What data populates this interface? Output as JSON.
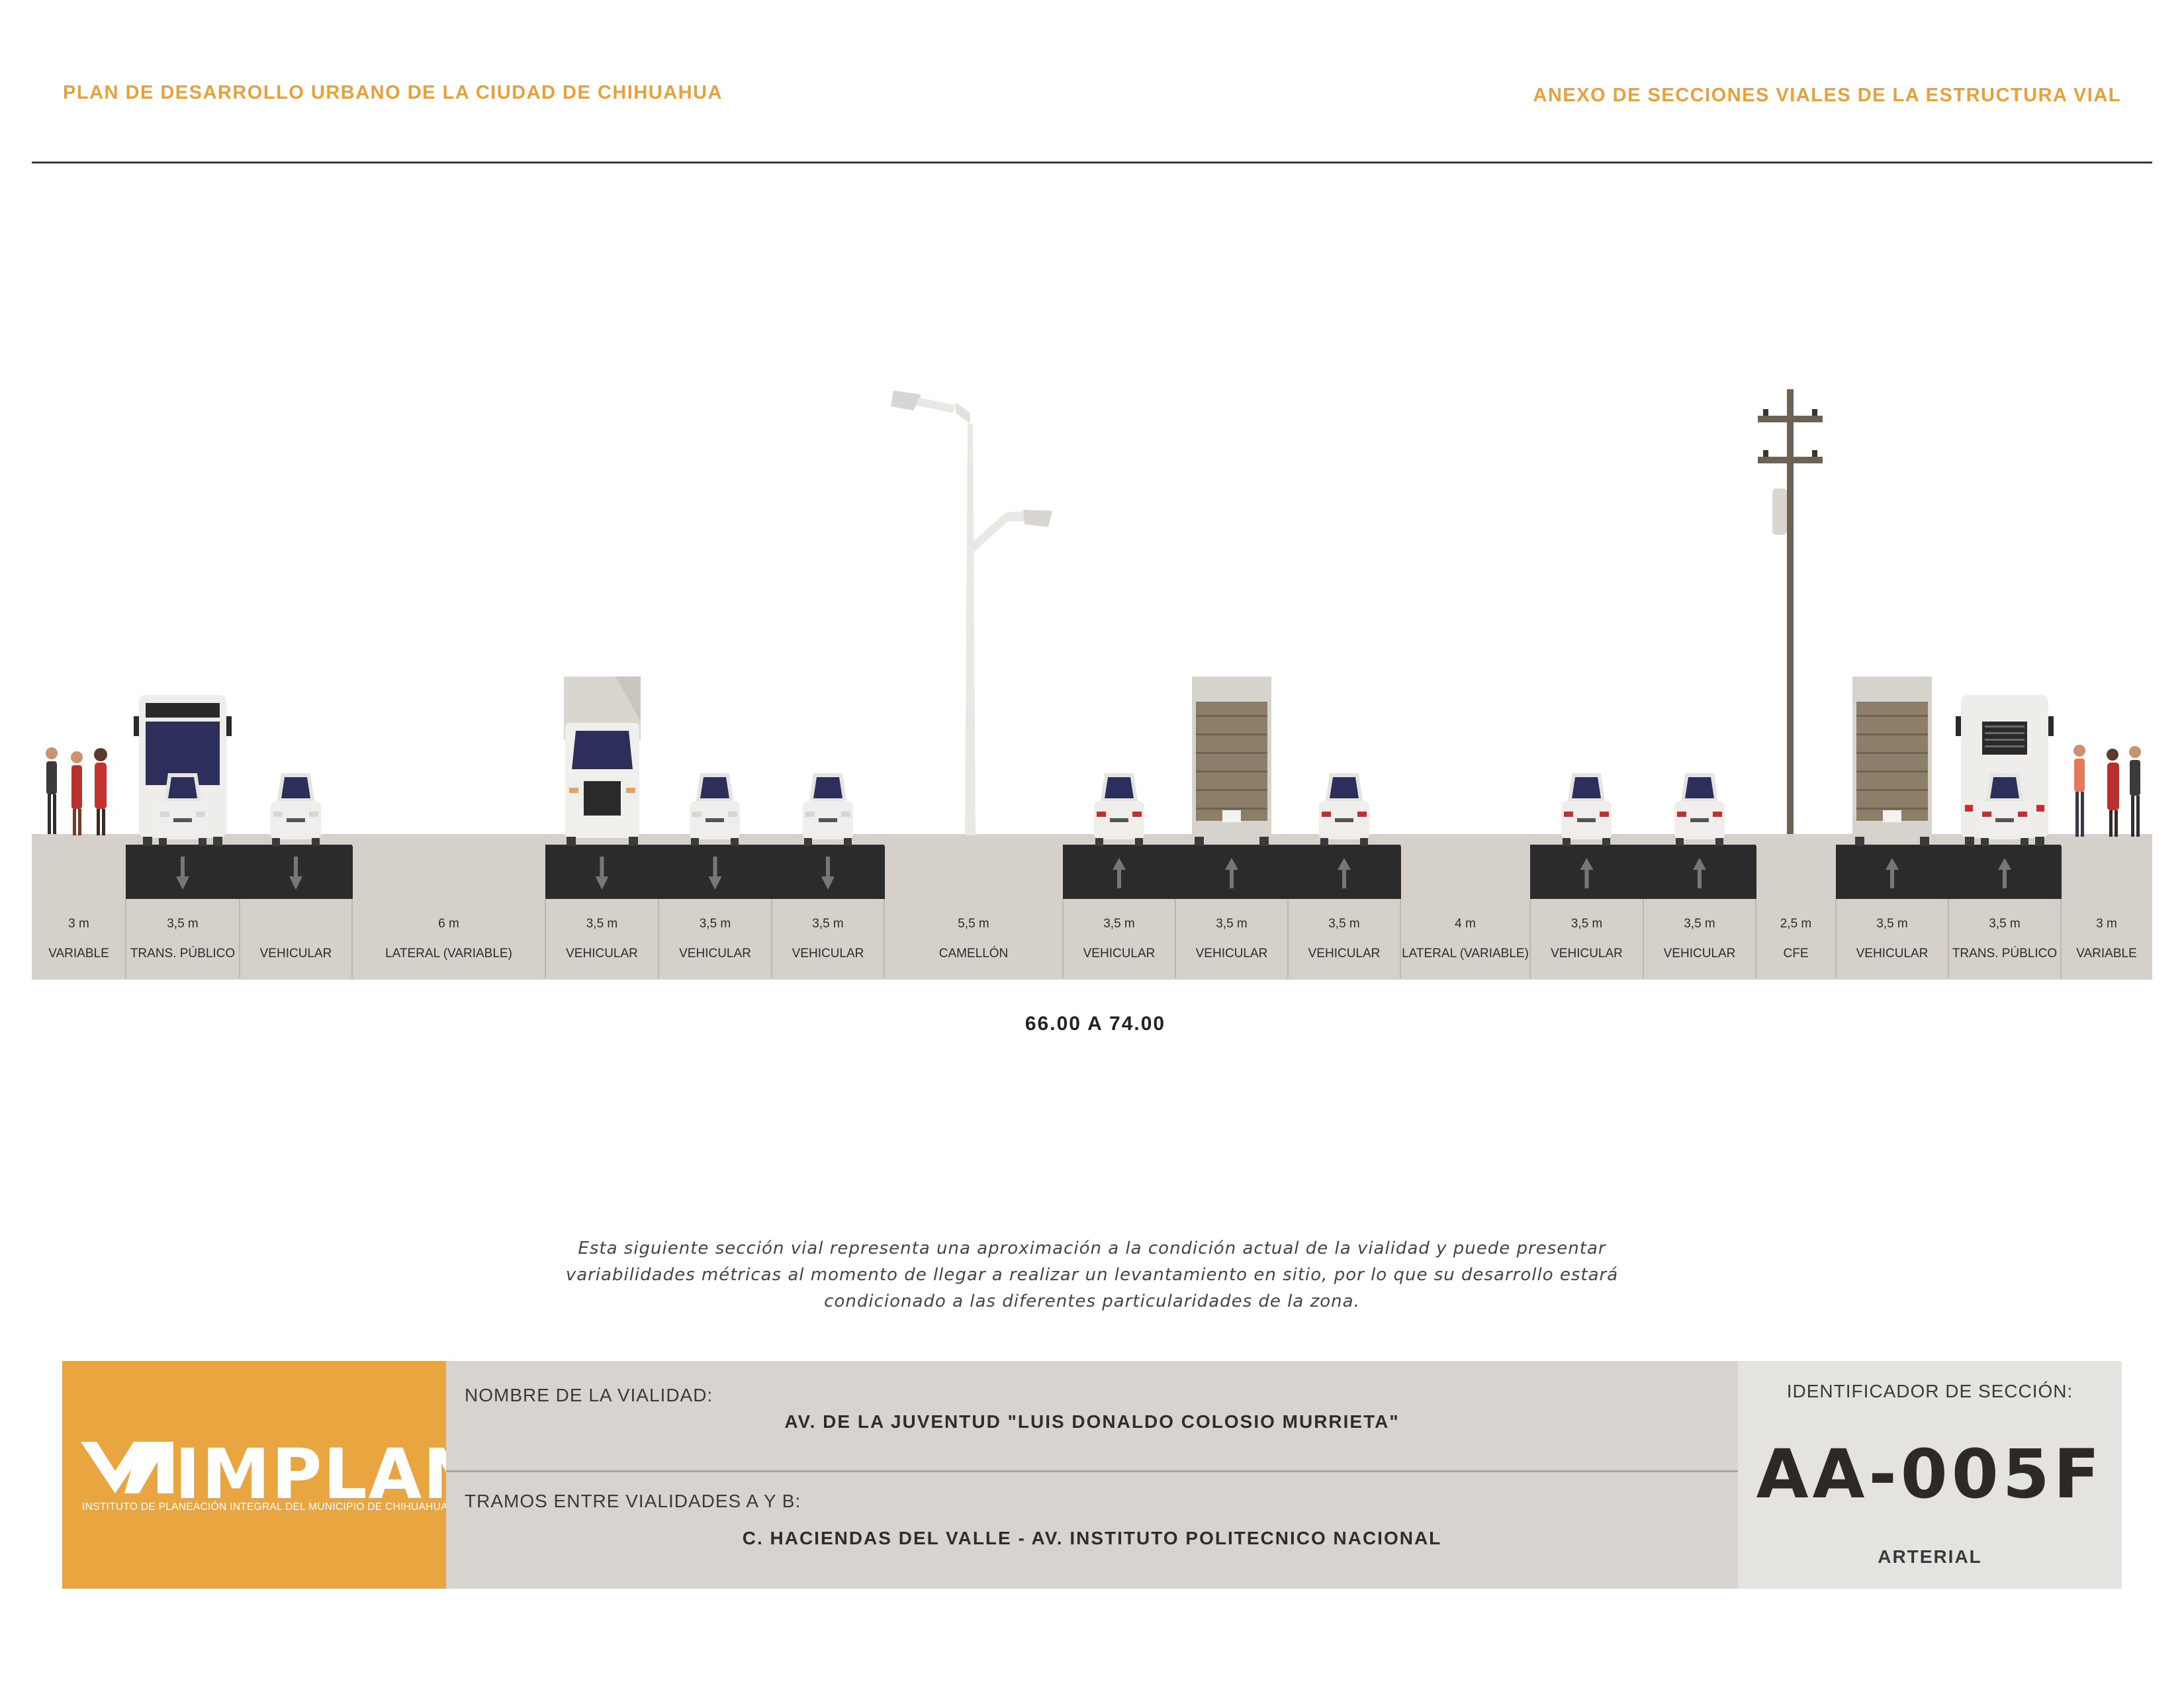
{
  "header": {
    "left_title": "PLAN DE DESARROLLO URBANO DE LA CIUDAD DE CHIHUAHUA",
    "right_title": "ANEXO DE SECCIONES VIALES DE LA ESTRUCTURA VIAL"
  },
  "section": {
    "segments": [
      {
        "width": "3 m",
        "use": "VARIABLE",
        "kind": "sidewalk",
        "direction": "none"
      },
      {
        "width": "3,5 m",
        "use": "TRANS. PÚBLICO",
        "kind": "lane",
        "direction": "down"
      },
      {
        "width": "",
        "use": "VEHICULAR",
        "kind": "lane",
        "direction": "down"
      },
      {
        "width": "6 m",
        "use": "LATERAL (VARIABLE)",
        "kind": "lateral",
        "direction": "none"
      },
      {
        "width": "3,5 m",
        "use": "VEHICULAR",
        "kind": "lane",
        "direction": "down"
      },
      {
        "width": "3,5 m",
        "use": "VEHICULAR",
        "kind": "lane",
        "direction": "down"
      },
      {
        "width": "3,5 m",
        "use": "VEHICULAR",
        "kind": "lane",
        "direction": "down"
      },
      {
        "width": "5,5 m",
        "use": "CAMELLÓN",
        "kind": "median",
        "direction": "none"
      },
      {
        "width": "3,5 m",
        "use": "VEHICULAR",
        "kind": "lane",
        "direction": "up"
      },
      {
        "width": "3,5 m",
        "use": "VEHICULAR",
        "kind": "lane",
        "direction": "up"
      },
      {
        "width": "3,5 m",
        "use": "VEHICULAR",
        "kind": "lane",
        "direction": "up"
      },
      {
        "width": "4 m",
        "use": "LATERAL (VARIABLE)",
        "kind": "lateral",
        "direction": "none"
      },
      {
        "width": "3,5 m",
        "use": "VEHICULAR",
        "kind": "lane",
        "direction": "up"
      },
      {
        "width": "3,5 m",
        "use": "VEHICULAR",
        "kind": "lane",
        "direction": "up"
      },
      {
        "width": "2,5 m",
        "use": "CFE",
        "kind": "median",
        "direction": "none"
      },
      {
        "width": "3,5 m",
        "use": "VEHICULAR",
        "kind": "lane",
        "direction": "up"
      },
      {
        "width": "3,5 m",
        "use": "TRANS. PÚBLICO",
        "kind": "lane",
        "direction": "up"
      },
      {
        "width": "3 m",
        "use": "VARIABLE",
        "kind": "sidewalk",
        "direction": "none"
      }
    ],
    "total_width": "66.00 A 74.00",
    "colors": {
      "pavement": "#2b2b2b",
      "curb": "#d5d0ca",
      "accent": "#e9a03b"
    }
  },
  "disclaimer": {
    "line1": "Esta siguiente sección vial representa una aproximación a la condición actual de la vialidad y puede presentar",
    "line2": "variabilidades métricas al momento de llegar a realizar un levantamiento en sitio, por lo que su desarrollo estará",
    "line3": "condicionado a las diferentes particularidades de la zona."
  },
  "card": {
    "logo_word": "IMPLAN",
    "logo_subtitle": "INSTITUTO DE PLANEACIÓN INTEGRAL DEL MUNICIPIO DE CHIHUAHUA",
    "road_name_label": "NOMBRE DE LA VIALIDAD:",
    "road_name": "AV. DE LA JUVENTUD \"LUIS DONALDO COLOSIO MURRIETA\"",
    "segment_label": "TRAMOS ENTRE VIALIDADES A Y B:",
    "segment_value": "C. HACIENDAS DEL VALLE - AV. INSTITUTO POLITECNICO NACIONAL",
    "id_label": "IDENTIFICADOR DE SECCIÓN:",
    "id_code": "AA-005F",
    "classification": "ARTERIAL"
  }
}
